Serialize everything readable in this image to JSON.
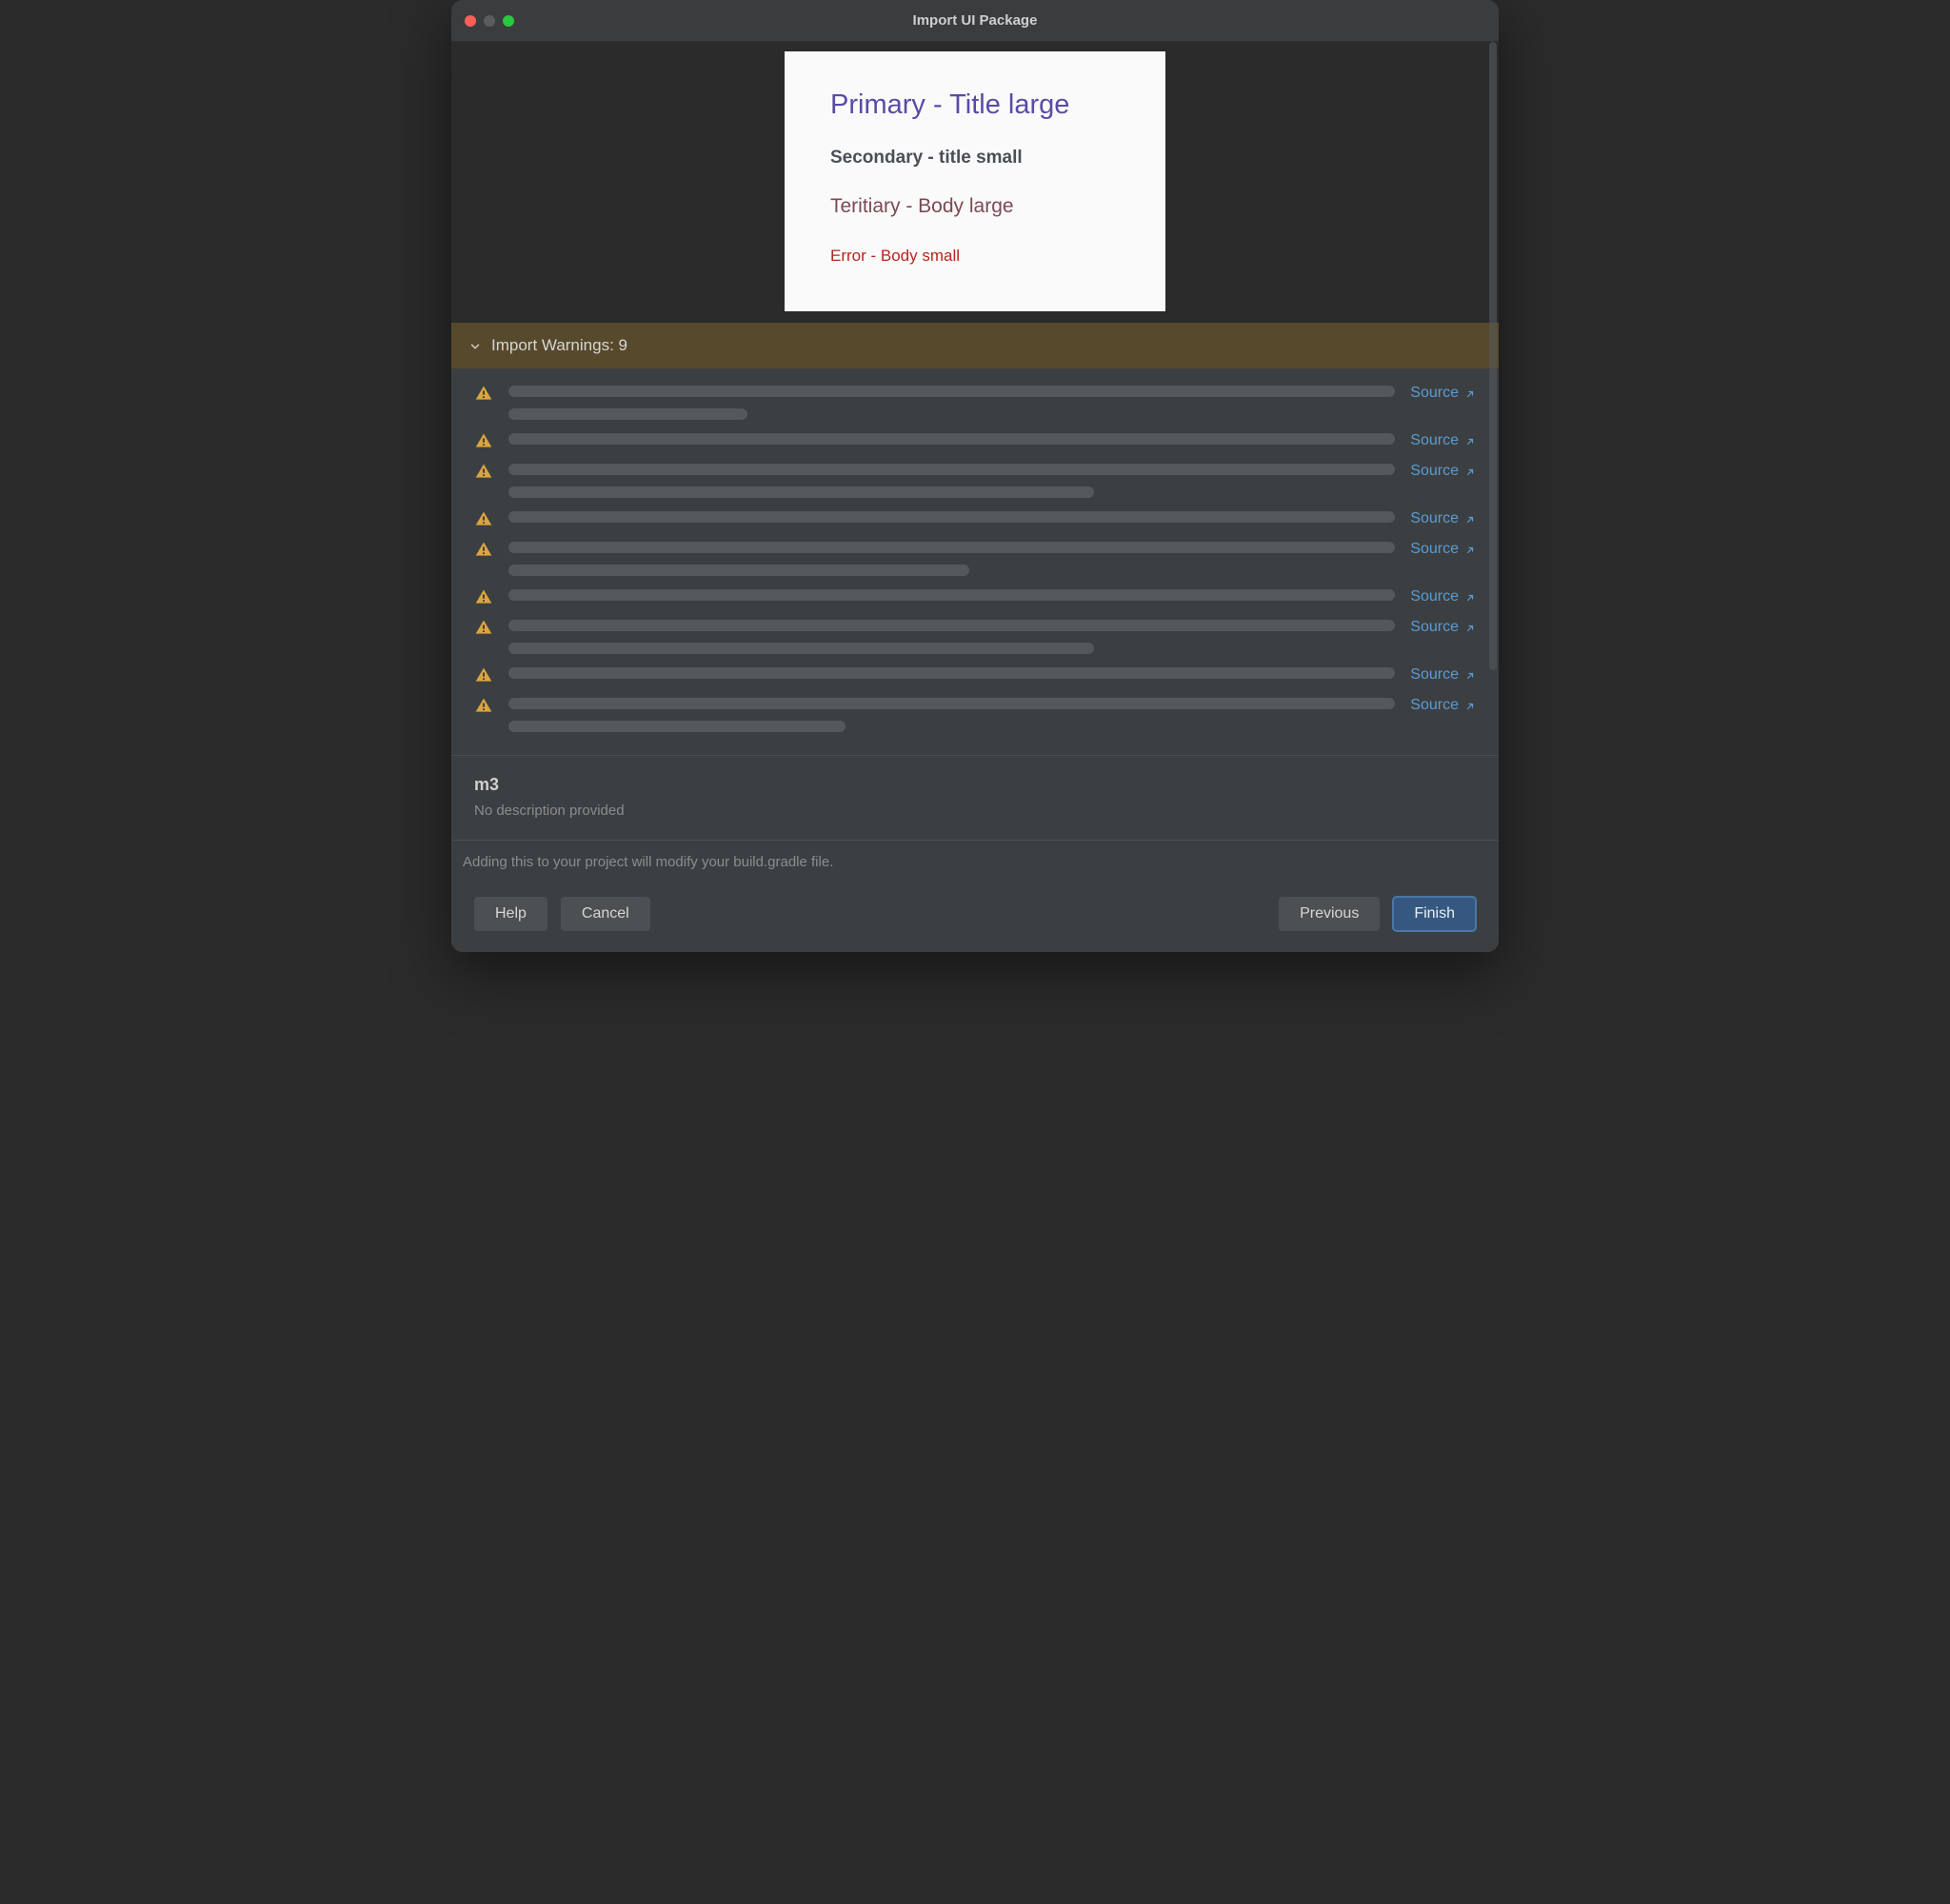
{
  "window": {
    "title": "Import UI Package"
  },
  "preview": {
    "primary": "Primary - Title large",
    "secondary": "Secondary - title small",
    "tertiary": "Teritiary - Body large",
    "error": "Error - Body small"
  },
  "warnings": {
    "header_label": "Import Warnings: 9",
    "source_label": "Source",
    "items": [
      {
        "lines": [
          100,
          27
        ]
      },
      {
        "lines": [
          100
        ]
      },
      {
        "lines": [
          100,
          66
        ]
      },
      {
        "lines": [
          100
        ]
      },
      {
        "lines": [
          100,
          52
        ]
      },
      {
        "lines": [
          100
        ]
      },
      {
        "lines": [
          100,
          66
        ]
      },
      {
        "lines": [
          100
        ]
      },
      {
        "lines": [
          100,
          38
        ]
      }
    ]
  },
  "meta": {
    "title": "m3",
    "description": "No description provided"
  },
  "footer": {
    "note": "Adding this to your project will modify your build.gradle file."
  },
  "buttons": {
    "help": "Help",
    "cancel": "Cancel",
    "previous": "Previous",
    "finish": "Finish"
  }
}
